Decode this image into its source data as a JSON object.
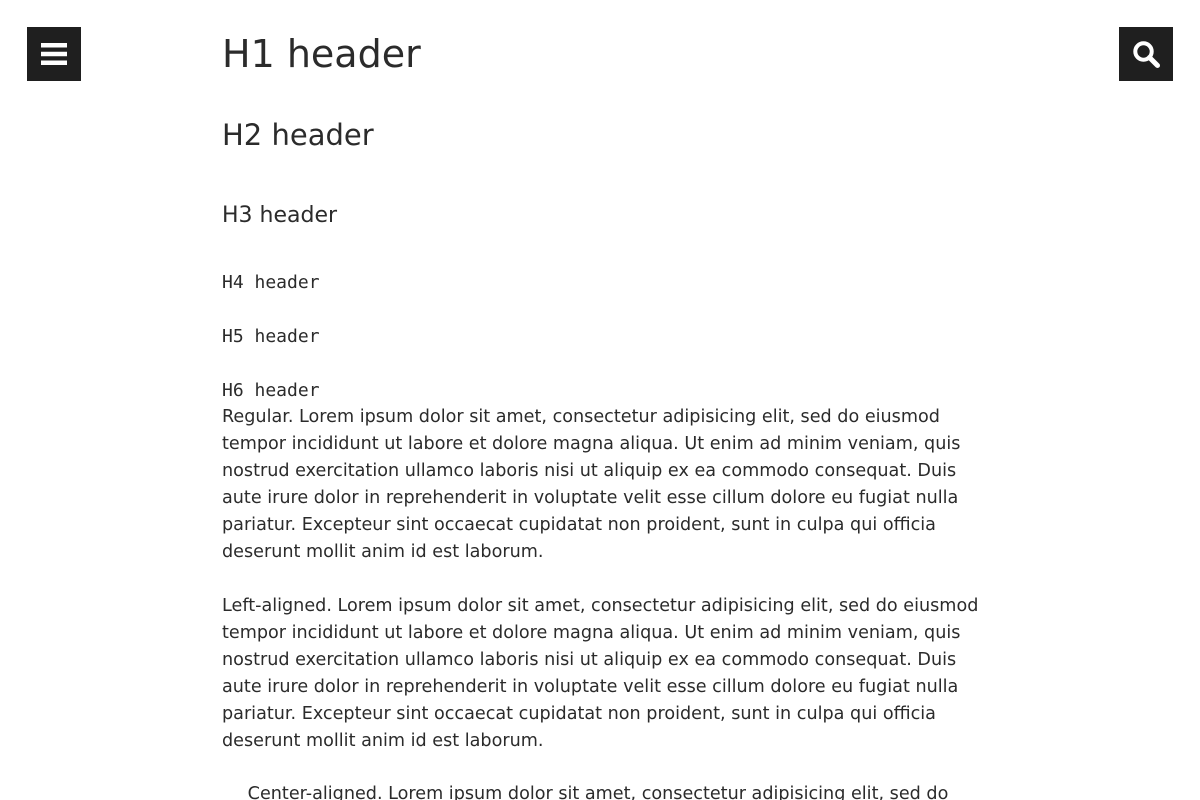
{
  "icons": {
    "menu": "hamburger-menu-icon",
    "search": "magnifier-search-icon"
  },
  "colors": {
    "icon_button_bg": "#1f1f1f",
    "text": "#2b2b2b",
    "background": "#ffffff"
  },
  "headers": {
    "h1": "H1 header",
    "h2": "H2 header",
    "h3": "H3 header",
    "h4": "H4 header",
    "h5": "H5 header",
    "h6": "H6 header"
  },
  "paragraphs": {
    "regular": "Regular. Lorem ipsum dolor sit amet, consectetur adipisicing elit, sed do eiusmod tempor incididunt ut labore et dolore magna aliqua. Ut enim ad minim veniam, quis nostrud exercitation ullamco laboris nisi ut aliquip ex ea commodo consequat. Duis aute irure dolor in reprehenderit in voluptate velit esse cillum dolore eu fugiat nulla pariatur. Excepteur sint occaecat cupidatat non proident, sunt in culpa qui officia deserunt mollit anim id est laborum.",
    "left_aligned": "Left-aligned. Lorem ipsum dolor sit amet, consectetur adipisicing elit, sed do eiusmod tempor incididunt ut labore et dolore magna aliqua. Ut enim ad minim veniam, quis nostrud exercitation ullamco laboris nisi ut aliquip ex ea commodo consequat. Duis aute irure dolor in reprehenderit in voluptate velit esse cillum dolore eu fugiat nulla pariatur. Excepteur sint occaecat cupidatat non proident, sunt in culpa qui officia deserunt mollit anim id est laborum.",
    "center_aligned": "Center-aligned. Lorem ipsum dolor sit amet, consectetur adipisicing elit, sed do"
  }
}
